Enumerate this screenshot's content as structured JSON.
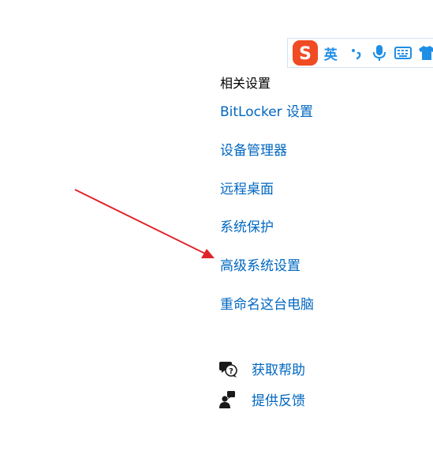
{
  "ime_toolbar": {
    "logo_letter": "S",
    "language": "英",
    "punctuation": "•,",
    "icons": [
      "sogou-logo-icon",
      "punctuation-icon",
      "microphone-icon",
      "keyboard-icon",
      "skin-shirt-icon"
    ],
    "brand_color": "#f04b23",
    "accent_color": "#1f8fe6"
  },
  "related_settings": {
    "title": "相关设置",
    "links": [
      "BitLocker 设置",
      "设备管理器",
      "远程桌面",
      "系统保护",
      "高级系统设置",
      "重命名这台电脑"
    ]
  },
  "help": {
    "get_help": "获取帮助",
    "give_feedback": "提供反馈"
  },
  "colors": {
    "link": "#0067c0",
    "annotation_arrow": "#e0242b"
  }
}
